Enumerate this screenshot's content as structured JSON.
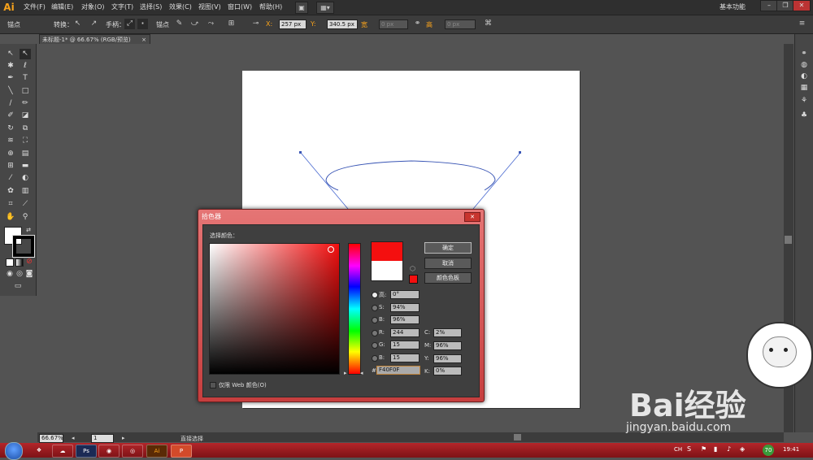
{
  "app": {
    "logo": "Ai",
    "workspace": "基本功能"
  },
  "menu": [
    "文件(F)",
    "编辑(E)",
    "对象(O)",
    "文字(T)",
    "选择(S)",
    "效果(C)",
    "视图(V)",
    "窗口(W)",
    "帮助(H)"
  ],
  "window_buttons": [
    "–",
    "❐",
    "✕"
  ],
  "control_bar": {
    "mode": "锚点",
    "convert": "转换：",
    "handle": "手柄：",
    "anchor": "锚点",
    "x_label": "X:",
    "x_value": "257 px",
    "y_label": "Y:",
    "y_value": "340.5 px",
    "w_label": "宽",
    "w_value": "0 px",
    "h_label": "高",
    "h_value": "0 px"
  },
  "document_tab": {
    "title": "未标题-1* @ 66.67% (RGB/预览)",
    "close": "×"
  },
  "status_bar": {
    "zoom": "66.67%",
    "page": "1",
    "tool": "直接选择"
  },
  "color_picker": {
    "title": "拾色器",
    "close": "✕",
    "select_color_label": "选择颜色：",
    "ok": "确定",
    "cancel": "取消",
    "swatches": "颜色色板",
    "h_label": "高:",
    "h_value": "0°",
    "s_label": "S:",
    "s_value": "94%",
    "b_label": "B:",
    "b_value": "96%",
    "r_label": "R:",
    "r_value": "244",
    "g_label": "G:",
    "g_value": "15",
    "bl_label": "B:",
    "bl_value": "15",
    "c_label": "C:",
    "c_value": "2%",
    "m_label": "M:",
    "m_value": "96%",
    "y_label": "Y:",
    "y_value": "96%",
    "k_label": "K:",
    "k_value": "0%",
    "hex_label": "#",
    "hex_value": "F40F0F",
    "web_only": "仅限 Web 颜色(O)",
    "new_color": "#F40F0F",
    "old_color": "#FFFFFF"
  },
  "taskbar": {
    "lang": "CH",
    "battery": "70",
    "time": "19:41",
    "app_ai": "Ai",
    "app_ps": "Ps",
    "app_p": "P"
  },
  "watermark": {
    "text": "Bai经验",
    "url": "jingyan.baidu.com"
  },
  "colors": {
    "accent": "#F40F0F",
    "ui_dark": "#535353",
    "dialog_frame": "#D65555"
  }
}
